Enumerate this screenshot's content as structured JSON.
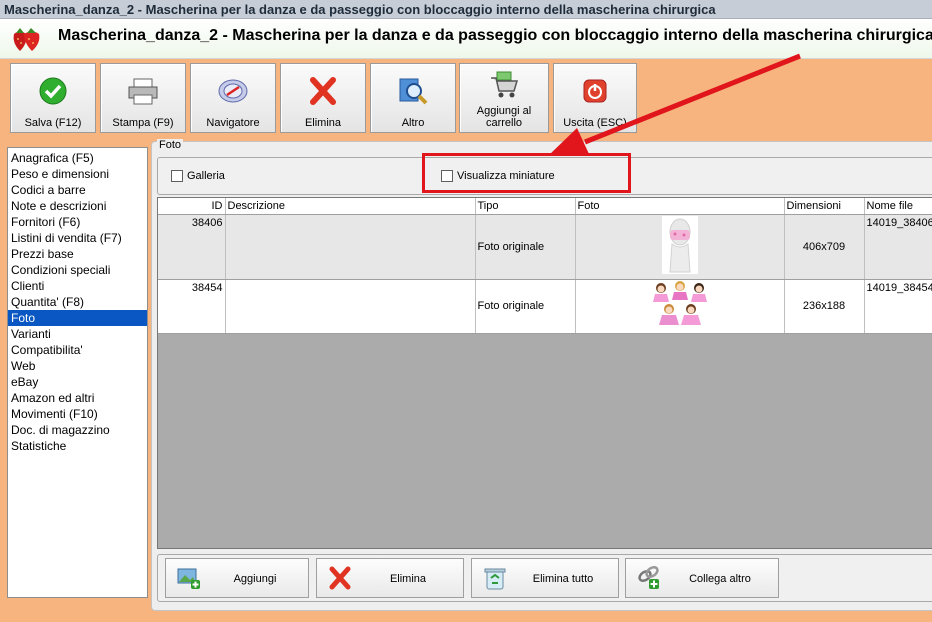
{
  "window": {
    "title": "Mascherina_danza_2 - Mascherina per la danza e da passeggio con bloccaggio interno della mascherina chirurgica"
  },
  "header": {
    "logo_icon": "strawberries-icon",
    "title": "Mascherina_danza_2 - Mascherina per la danza e da passeggio con bloccaggio interno della mascherina chirurgica"
  },
  "toolbar": {
    "buttons": [
      {
        "label": "Salva (F12)",
        "icon": "green-check-icon"
      },
      {
        "label": "Stampa (F9)",
        "icon": "printer-icon"
      },
      {
        "label": "Navigatore",
        "icon": "compass-icon"
      },
      {
        "label": "Elimina",
        "icon": "red-x-icon"
      },
      {
        "label": "Altro",
        "icon": "magnifier-icon"
      },
      {
        "label": "Aggiungi al carrello",
        "icon": "cart-icon"
      },
      {
        "label": "Uscita (ESC)",
        "icon": "power-icon"
      }
    ]
  },
  "sidebar": {
    "items": [
      {
        "label": "Anagrafica (F5)"
      },
      {
        "label": "Peso e dimensioni"
      },
      {
        "label": "Codici a barre"
      },
      {
        "label": "Note e descrizioni"
      },
      {
        "label": "Fornitori (F6)"
      },
      {
        "label": "Listini di vendita (F7)"
      },
      {
        "label": "Prezzi base"
      },
      {
        "label": "Condizioni speciali"
      },
      {
        "label": "Clienti"
      },
      {
        "label": "Quantita' (F8)"
      },
      {
        "label": "Foto"
      },
      {
        "label": "Varianti"
      },
      {
        "label": "Compatibilita'"
      },
      {
        "label": "Web"
      },
      {
        "label": "eBay"
      },
      {
        "label": "Amazon ed altri"
      },
      {
        "label": "Movimenti (F10)"
      },
      {
        "label": "Doc. di magazzino"
      },
      {
        "label": "Statistiche"
      }
    ],
    "selected": "Foto"
  },
  "panel": {
    "legend": "Foto",
    "galleria_label": "Galleria",
    "galleria_checked": false,
    "miniature_label": "Visualizza miniature",
    "miniature_checked": false
  },
  "grid": {
    "columns": [
      "ID",
      "Descrizione",
      "Tipo",
      "Foto",
      "Dimensioni",
      "Nome file"
    ],
    "rows": [
      {
        "id": "38406",
        "descrizione": "",
        "tipo": "Foto originale",
        "foto": "mannequin-mask-thumbnail",
        "dimensioni": "406x709",
        "nome_file": "14019_38406"
      },
      {
        "id": "38454",
        "descrizione": "",
        "tipo": "Foto originale",
        "foto": "ballerinas-thumbnail",
        "dimensioni": "236x188",
        "nome_file": "14019_38454"
      }
    ]
  },
  "bottom": {
    "buttons": [
      {
        "label": "Aggiungi",
        "icon": "add-image-icon"
      },
      {
        "label": "Elimina",
        "icon": "red-x-icon"
      },
      {
        "label": "Elimina tutto",
        "icon": "recycle-bin-icon"
      },
      {
        "label": "Collega altro",
        "icon": "link-add-icon"
      }
    ]
  },
  "annotation": {
    "color": "#e0161c"
  },
  "colors": {
    "background": "#f8b47e",
    "selection": "#0a57c4"
  }
}
